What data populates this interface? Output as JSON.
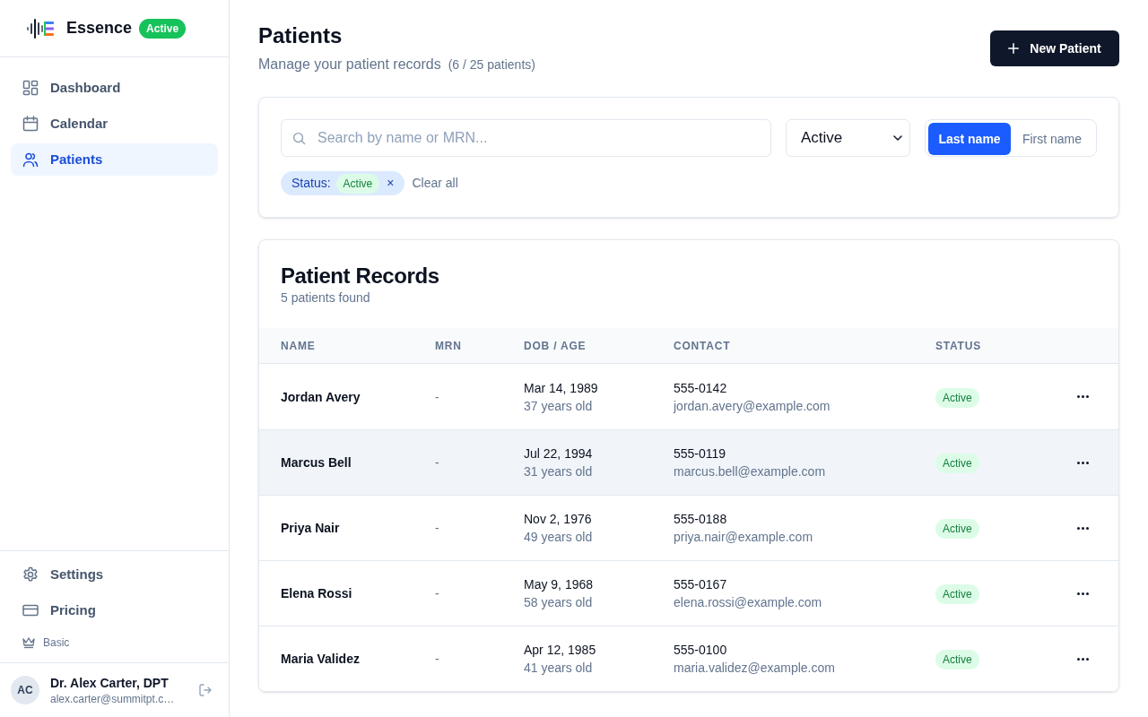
{
  "sidebar": {
    "brand": {
      "name": "Essence",
      "badge": "Active"
    },
    "nav": [
      {
        "label": "Dashboard",
        "selected": false
      },
      {
        "label": "Calendar",
        "selected": false
      },
      {
        "label": "Patients",
        "selected": true
      }
    ],
    "footer_nav": [
      {
        "label": "Settings",
        "selected": false
      },
      {
        "label": "Pricing",
        "selected": false
      }
    ],
    "plan": "Basic",
    "user": {
      "initials": "AC",
      "name": "Dr. Alex Carter, DPT",
      "email": "alex.carter@summitpt.c…"
    }
  },
  "header": {
    "title": "Patients",
    "subtitle": "Manage your patient records",
    "count": "(6 / 25 patients)",
    "primary_button": "New Patient"
  },
  "filters": {
    "search": {
      "placeholder": "Search by name or MRN..."
    },
    "status_select": {
      "value": "Active"
    },
    "sort_toggle": [
      {
        "label": "Last name",
        "selected": true
      },
      {
        "label": "First name",
        "selected": false
      }
    ],
    "chips": [
      {
        "label": "Status:",
        "value": "Active",
        "remove": "×"
      }
    ],
    "clear_all": "Clear all"
  },
  "table": {
    "title": "Patient Records",
    "subtitle": "5 patients found",
    "columns": [
      "NAME",
      "MRN",
      "DOB / AGE",
      "CONTACT",
      "STATUS"
    ],
    "rows": [
      {
        "name": "Jordan Avery",
        "mrn": "-",
        "dob": "Mar 14, 1989",
        "age": "37 years old",
        "phone": "555-0142",
        "email": "jordan.avery@example.com",
        "status": "Active",
        "hovered": false
      },
      {
        "name": "Marcus Bell",
        "mrn": "-",
        "dob": "Jul 22, 1994",
        "age": "31 years old",
        "phone": "555-0119",
        "email": "marcus.bell@example.com",
        "status": "Active",
        "hovered": true
      },
      {
        "name": "Priya Nair",
        "mrn": "-",
        "dob": "Nov 2, 1976",
        "age": "49 years old",
        "phone": "555-0188",
        "email": "priya.nair@example.com",
        "status": "Active",
        "hovered": false
      },
      {
        "name": "Elena Rossi",
        "mrn": "-",
        "dob": "May 9, 1968",
        "age": "58 years old",
        "phone": "555-0167",
        "email": "elena.rossi@example.com",
        "status": "Active",
        "hovered": false
      },
      {
        "name": "Maria Validez",
        "mrn": "-",
        "dob": "Apr 12, 1985",
        "age": "41 years old",
        "phone": "555-0100",
        "email": "maria.validez@example.com",
        "status": "Active",
        "hovered": false
      }
    ]
  }
}
